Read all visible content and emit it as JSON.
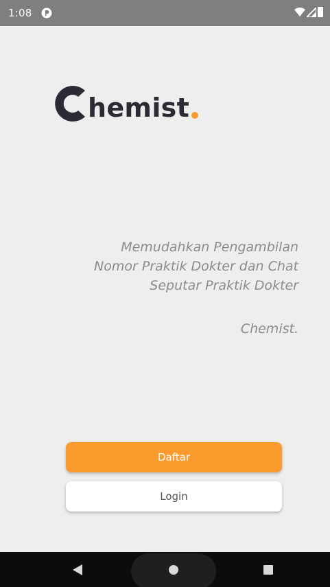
{
  "status_bar": {
    "time": "1:08",
    "icons": [
      "app-notification-icon",
      "wifi-icon",
      "signal-icon",
      "battery-icon"
    ]
  },
  "logo": {
    "text": "hemist",
    "accent_color": "#fb9b2e",
    "dark_color": "#2a2b35"
  },
  "tagline": {
    "lines": [
      "Memudahkan Pengambilan",
      "Nomor Praktik Dokter dan Chat",
      "Seputar Praktik Dokter"
    ],
    "signature": "Chemist."
  },
  "buttons": {
    "daftar_label": "Daftar",
    "login_label": "Login"
  },
  "nav_bar": {
    "icons": [
      "back-icon",
      "home-icon",
      "recents-icon"
    ]
  },
  "colors": {
    "background": "#eeeeee",
    "accent": "#fb9b2e",
    "status_bar": "#7f7f7f",
    "nav_bar": "#0c0c0c"
  }
}
